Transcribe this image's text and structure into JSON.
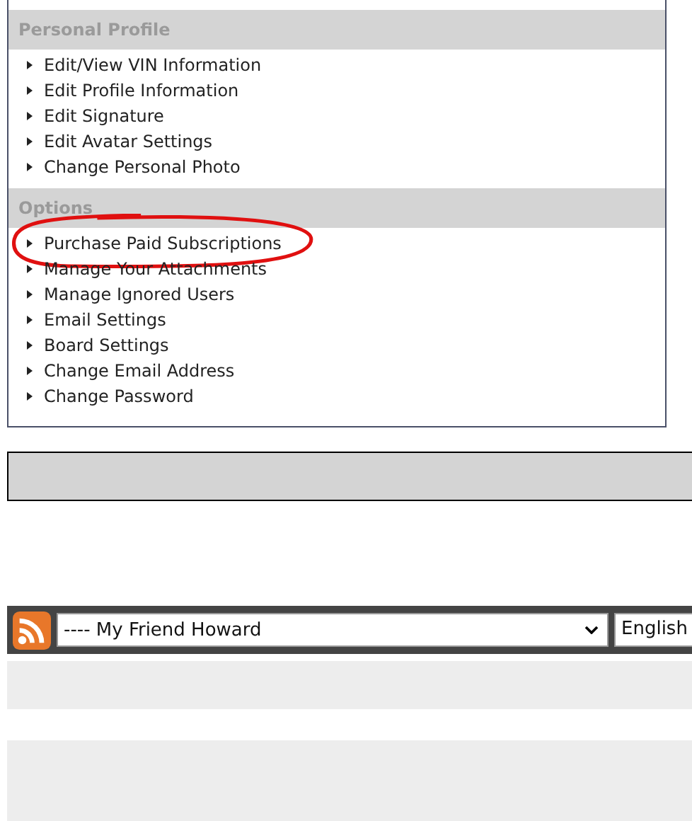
{
  "sections": [
    {
      "title": "Personal Profile",
      "items": [
        {
          "label": "Edit/View VIN Information",
          "circled": false
        },
        {
          "label": "Edit Profile Information",
          "circled": false
        },
        {
          "label": "Edit Signature",
          "circled": false
        },
        {
          "label": "Edit Avatar Settings",
          "circled": false
        },
        {
          "label": "Change Personal Photo",
          "circled": false
        }
      ]
    },
    {
      "title": "Options",
      "items": [
        {
          "label": "Purchase Paid Subscriptions",
          "circled": true
        },
        {
          "label": "Manage Your Attachments",
          "circled": false
        },
        {
          "label": "Manage Ignored Users",
          "circled": false
        },
        {
          "label": "Email Settings",
          "circled": false
        },
        {
          "label": "Board Settings",
          "circled": false
        },
        {
          "label": "Change Email Address",
          "circled": false
        },
        {
          "label": "Change Password",
          "circled": false
        }
      ]
    }
  ],
  "footer": {
    "style_select": "---- My Friend Howard",
    "language_select": "English"
  }
}
